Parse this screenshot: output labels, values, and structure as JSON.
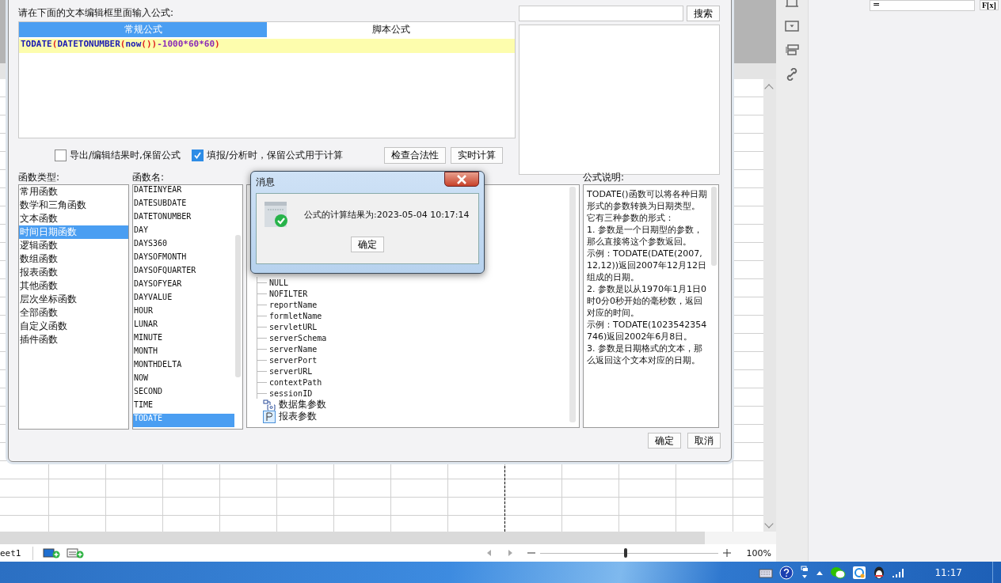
{
  "dialog": {
    "prompt": "请在下面的文本编辑框里面输入公式:",
    "search_button": "搜索",
    "editor_tabs": [
      {
        "label": "常规公式",
        "selected": true
      },
      {
        "label": "脚本公式",
        "selected": false
      }
    ],
    "formula": [
      {
        "text": "TODATE",
        "kind": "function"
      },
      {
        "text": "(",
        "kind": "bracket"
      },
      {
        "text": "DATETONUMBER",
        "kind": "function"
      },
      {
        "text": "(",
        "kind": "bracket"
      },
      {
        "text": "now",
        "kind": "function"
      },
      {
        "text": "())",
        "kind": "bracket"
      },
      {
        "text": "-1000*60*60",
        "kind": "number"
      },
      {
        "text": ")",
        "kind": "bracket"
      }
    ],
    "options": [
      {
        "label": "导出/编辑结果时,保留公式",
        "checked": false
      },
      {
        "label": "填报/分析时，保留公式用于计算",
        "checked": true
      }
    ],
    "action_buttons": [
      "检查合法性",
      "实时计算"
    ],
    "function_types": {
      "label": "函数类型:",
      "items": [
        {
          "label": "常用函数",
          "selected": false
        },
        {
          "label": "数学和三角函数",
          "selected": false
        },
        {
          "label": "文本函数",
          "selected": false
        },
        {
          "label": "时间日期函数",
          "selected": true
        },
        {
          "label": "逻辑函数",
          "selected": false
        },
        {
          "label": "数组函数",
          "selected": false
        },
        {
          "label": "报表函数",
          "selected": false
        },
        {
          "label": "其他函数",
          "selected": false
        },
        {
          "label": "层次坐标函数",
          "selected": false
        },
        {
          "label": "全部函数",
          "selected": false
        },
        {
          "label": "自定义函数",
          "selected": false
        },
        {
          "label": "插件函数",
          "selected": false
        }
      ]
    },
    "function_names": {
      "label": "函数名:",
      "items": [
        {
          "label": "DATEINYEAR",
          "selected": false
        },
        {
          "label": "DATESUBDATE",
          "selected": false
        },
        {
          "label": "DATETONUMBER",
          "selected": false
        },
        {
          "label": "DAY",
          "selected": false
        },
        {
          "label": "DAYS360",
          "selected": false
        },
        {
          "label": "DAYSOFMONTH",
          "selected": false
        },
        {
          "label": "DAYSOFQUARTER",
          "selected": false
        },
        {
          "label": "DAYSOFYEAR",
          "selected": false
        },
        {
          "label": "DAYVALUE",
          "selected": false
        },
        {
          "label": "HOUR",
          "selected": false
        },
        {
          "label": "LUNAR",
          "selected": false
        },
        {
          "label": "MINUTE",
          "selected": false
        },
        {
          "label": "MONTH",
          "selected": false
        },
        {
          "label": "MONTHDELTA",
          "selected": false
        },
        {
          "label": "NOW",
          "selected": false
        },
        {
          "label": "SECOND",
          "selected": false
        },
        {
          "label": "TIME",
          "selected": false
        },
        {
          "label": "TODATE",
          "selected": true
        }
      ]
    },
    "tree": {
      "nodes": [
        {
          "children": [
            {
              "label": "NULL"
            },
            {
              "label": "NOFILTER"
            },
            {
              "label": "reportName"
            },
            {
              "label": "formletName"
            },
            {
              "label": "servletURL"
            },
            {
              "label": "serverSchema"
            },
            {
              "label": "serverName"
            },
            {
              "label": "serverPort"
            },
            {
              "label": "serverURL"
            },
            {
              "label": "contextPath"
            },
            {
              "label": "sessionID"
            }
          ]
        },
        {
          "label": "数据集参数",
          "kind": "dataset"
        },
        {
          "label": "报表参数",
          "kind": "report"
        }
      ]
    },
    "description": {
      "label": "公式说明:",
      "paragraphs": [
        "TODATE()函数可以将各种日期形式的参数转换为日期类型。",
        "它有三种参数的形式：",
        "1. 参数是一个日期型的参数，那么直接将这个参数返回。",
        "示例：TODATE(DATE(2007,12,12))返回2007年12月12日组成的日期。",
        "2. 参数是以从1970年1月1日0时0分0秒开始的毫秒数，返回对应的时间。",
        "示例：TODATE(1023542354746)返回2002年6月8日。",
        "3. 参数是日期格式的文本，那么返回这个文本对应的日期。"
      ]
    },
    "buttons": [
      "确定",
      "取消"
    ]
  },
  "message_box": {
    "title": "消息",
    "text": "公式的计算结果为:2023-05-04 10:17:14",
    "button": "确定"
  },
  "properties": {
    "value": "=",
    "button": "F[x]"
  },
  "sheet": {
    "tab": "eet1",
    "zoom": "100%",
    "zoom_slider": {
      "level": 0.48
    }
  },
  "taskbar": {
    "time": "11:17"
  }
}
